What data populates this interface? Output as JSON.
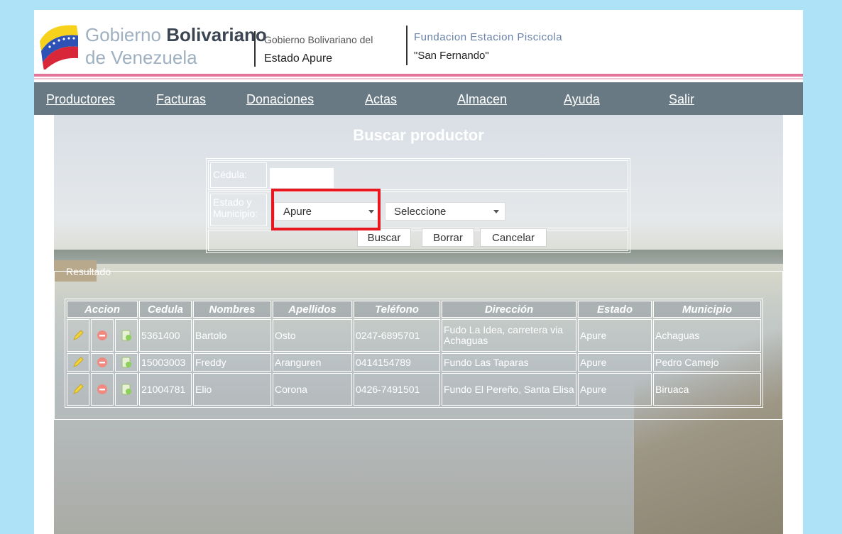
{
  "header": {
    "gob_title_light": "Gobierno",
    "gob_title_bold": "Bolivariano",
    "gob_subtitle": "de Venezuela",
    "apure_line1": "Gobierno Bolivariano del",
    "apure_line2": "Estado Apure",
    "fundacion_line1": "Fundacion Estacion Piscicola",
    "fundacion_line2": "\"San Fernando\""
  },
  "nav": {
    "items": [
      "Productores",
      "Facturas",
      "Donaciones",
      "Actas",
      "Almacen",
      "Ayuda",
      "Salir"
    ]
  },
  "page_title": "Buscar productor",
  "form": {
    "cedula_label": "Cédula:",
    "cedula_value": "",
    "estado_label": "Estado y Municipio:",
    "estado_selected": "Apure",
    "municipio_selected": "Seleccione",
    "buttons": {
      "buscar": "Buscar",
      "borrar": "Borrar",
      "cancelar": "Cancelar"
    }
  },
  "results": {
    "legend": "Resultado",
    "columns": [
      "Accion",
      "Cedula",
      "Nombres",
      "Apellidos",
      "Teléfono",
      "Dirección",
      "Estado",
      "Municipio"
    ],
    "rows": [
      {
        "cedula": "5361400",
        "nombres": "Bartolo",
        "apellidos": "Osto",
        "telefono": "0247-6895701",
        "direccion": "Fudo La Idea, carretera via Achaguas",
        "estado": "Apure",
        "municipio": "Achaguas"
      },
      {
        "cedula": "15003003",
        "nombres": "Freddy",
        "apellidos": "Aranguren",
        "telefono": "0414154789",
        "direccion": "Fundo Las Taparas",
        "estado": "Apure",
        "municipio": "Pedro Camejo"
      },
      {
        "cedula": "21004781",
        "nombres": "Elio",
        "apellidos": "Corona",
        "telefono": "0426-7491501",
        "direccion": "Fundo El Pereño, Santa Elisa",
        "estado": "Apure",
        "municipio": "Biruaca"
      }
    ]
  },
  "colors": {
    "page_bg": "#aee3f7",
    "nav_bg": "#687983",
    "header_line": "#e2749a",
    "highlight": "#e8161e"
  },
  "icons": [
    "edit-icon",
    "delete-icon",
    "view-icon"
  ]
}
